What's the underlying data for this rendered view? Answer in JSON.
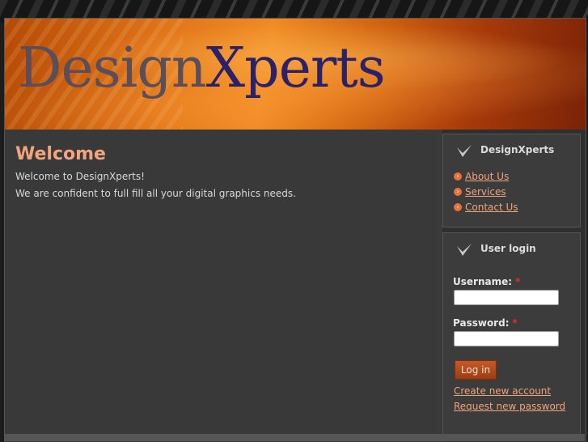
{
  "header": {
    "logo_part1": "Design",
    "logo_part2": "Xperts"
  },
  "main": {
    "title": "Welcome",
    "lines": [
      "Welcome to DesignXperts!",
      "We are confident to full fill all your digital graphics needs."
    ]
  },
  "sidebar": {
    "nav_block": {
      "title": "DesignXperts",
      "items": [
        "About Us",
        "Services",
        "Contact Us"
      ]
    },
    "login_block": {
      "title": "User login",
      "username_label": "Username:",
      "password_label": "Password:",
      "required_mark": "*",
      "login_button": "Log in",
      "create_account": "Create new account",
      "request_password": "Request new password"
    }
  },
  "colors": {
    "accent": "#f0a47a",
    "header_orange": "#e2761a",
    "logo_navy": "#2a2168",
    "required": "#e03030"
  },
  "icons": {
    "block_title": "checkmark-icon",
    "list_bullet": "arrow-bullet-icon"
  }
}
